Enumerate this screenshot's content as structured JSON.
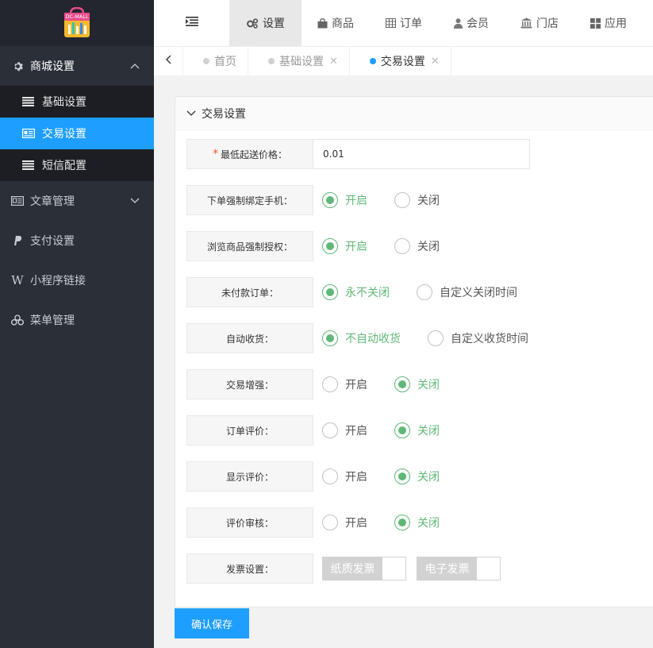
{
  "logo": {
    "text": "DC-MALL"
  },
  "sidebar": {
    "menu": [
      {
        "label": "商城设置",
        "icon": "gear-icon",
        "open": true,
        "children": [
          {
            "label": "基础设置",
            "icon": "list-icon",
            "active": false
          },
          {
            "label": "交易设置",
            "icon": "card-icon",
            "active": true
          },
          {
            "label": "短信配置",
            "icon": "list-icon",
            "active": false
          }
        ]
      },
      {
        "label": "文章管理",
        "icon": "newspaper-icon"
      },
      {
        "label": "支付设置",
        "icon": "paypal-icon"
      },
      {
        "label": "小程序链接",
        "icon": "w-icon"
      },
      {
        "label": "菜单管理",
        "icon": "cubes-icon"
      }
    ]
  },
  "topnav": {
    "tabs": [
      {
        "label": "设置",
        "icon": "gears-icon",
        "active": true
      },
      {
        "label": "商品",
        "icon": "bag-icon"
      },
      {
        "label": "订单",
        "icon": "table-icon"
      },
      {
        "label": "会员",
        "icon": "user-icon"
      },
      {
        "label": "门店",
        "icon": "bank-icon"
      },
      {
        "label": "应用",
        "icon": "grid-icon"
      }
    ]
  },
  "pagetabs": [
    {
      "label": "首页",
      "closable": false,
      "active": false
    },
    {
      "label": "基础设置",
      "closable": true,
      "active": false
    },
    {
      "label": "交易设置",
      "closable": true,
      "active": true
    }
  ],
  "panel": {
    "title": "交易设置",
    "min_price": {
      "label": "最低起送价格：",
      "value": "0.01"
    },
    "rows": [
      {
        "key": "bind_phone",
        "label": "下单强制绑定手机：",
        "options": [
          "开启",
          "关闭"
        ],
        "selected": 0
      },
      {
        "key": "force_auth",
        "label": "浏览商品强制授权：",
        "options": [
          "开启",
          "关闭"
        ],
        "selected": 0
      },
      {
        "key": "unpaid",
        "label": "未付款订单：",
        "options": [
          "永不关闭",
          "自定义关闭时间"
        ],
        "selected": 0
      },
      {
        "key": "auto_receive",
        "label": "自动收货：",
        "options": [
          "不自动收货",
          "自定义收货时间"
        ],
        "selected": 0
      },
      {
        "key": "trade_enhance",
        "label": "交易增强：",
        "options": [
          "开启",
          "关闭"
        ],
        "selected": 1
      },
      {
        "key": "order_review",
        "label": "订单评价：",
        "options": [
          "开启",
          "关闭"
        ],
        "selected": 1
      },
      {
        "key": "show_review",
        "label": "显示评价：",
        "options": [
          "开启",
          "关闭"
        ],
        "selected": 1
      },
      {
        "key": "review_audit",
        "label": "评价审核：",
        "options": [
          "开启",
          "关闭"
        ],
        "selected": 1
      }
    ],
    "invoice": {
      "label": "发票设置：",
      "switches": [
        "纸质发票",
        "电子发票"
      ]
    }
  },
  "save_label": "确认保存",
  "colors": {
    "accent": "#1e9fff",
    "green": "#5fb878",
    "sidebar": "#2b2f38"
  }
}
